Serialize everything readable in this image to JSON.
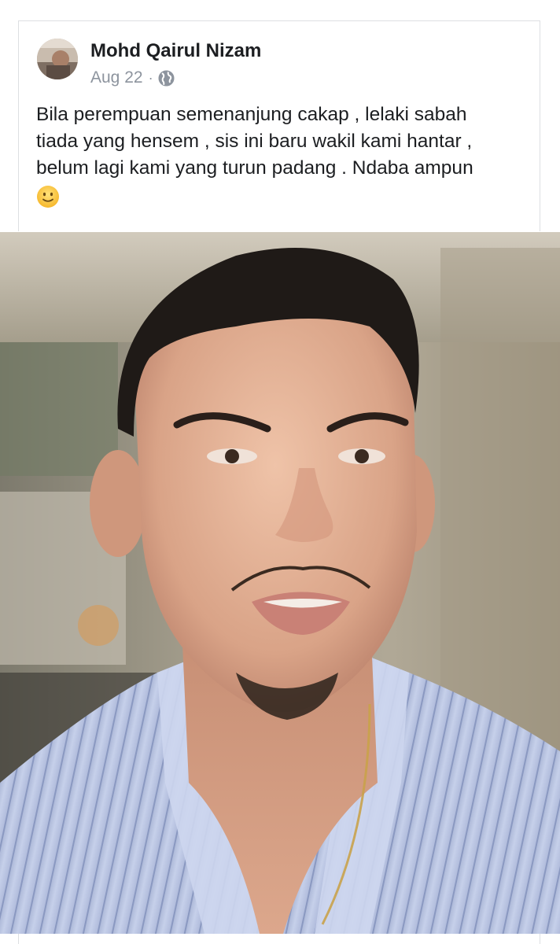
{
  "post": {
    "author": "Mohd Qairul Nizam",
    "date": "Aug 22",
    "separator": "·",
    "privacy_icon": "globe-icon",
    "text_lines": [
      "Bila perempuan semenanjung cakap , lelaki sabah",
      "tiada yang hensem , sis ini baru wakil kami hantar ,",
      "belum lagi kami yang turun padang . Ndaba ampun"
    ],
    "emoji_icon": "slightly-smiling-face-icon"
  },
  "photo": {
    "subject": "portrait-photo"
  },
  "colors": {
    "text": "#1c1e21",
    "meta": "#8d949e",
    "border": "#dddfe2",
    "shirt": "#bcc8e6",
    "skin": "#dfae95"
  }
}
